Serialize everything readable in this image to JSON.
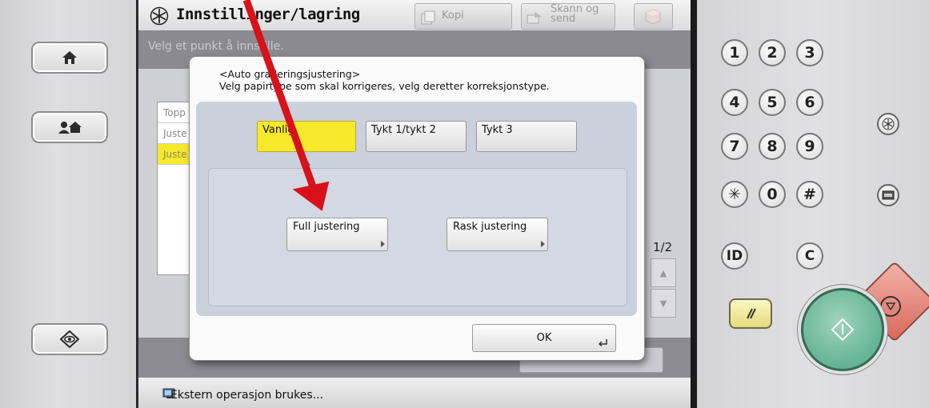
{
  "screen": {
    "title": "Innstillinger/lagring",
    "tabs": [
      {
        "label": "Kopi"
      },
      {
        "label_line1": "Skann og",
        "label_line2": "send"
      }
    ],
    "subtitle": "Velg et punkt å innstille.",
    "list_items": [
      "Topp",
      "Juste",
      "Juste"
    ],
    "page_indicator": "1/2",
    "status_text": "Ekstern operasjon brukes..."
  },
  "modal": {
    "title": "<Auto graderingsjustering>",
    "instruction": "Velg papirtype som skal korrigeres, velg deretter korreksjonstype.",
    "paper_types": [
      {
        "label": "Vanlig",
        "selected": true
      },
      {
        "label": "Tykt 1/tykt 2",
        "selected": false
      },
      {
        "label": "Tykt 3",
        "selected": false
      }
    ],
    "correction_types": [
      {
        "label": "Full justering"
      },
      {
        "label": "Rask justering"
      }
    ],
    "ok_label": "OK"
  },
  "keypad": {
    "digits": [
      "1",
      "2",
      "3",
      "4",
      "5",
      "6",
      "7",
      "8",
      "9",
      "✳",
      "0",
      "#"
    ],
    "id_label": "ID",
    "clear_label": "C"
  },
  "colors": {
    "selected_yellow": "#f6e92a",
    "annotation_arrow": "#d8111a",
    "start_button": "#5fb494",
    "stop_button": "#e28a7c"
  }
}
